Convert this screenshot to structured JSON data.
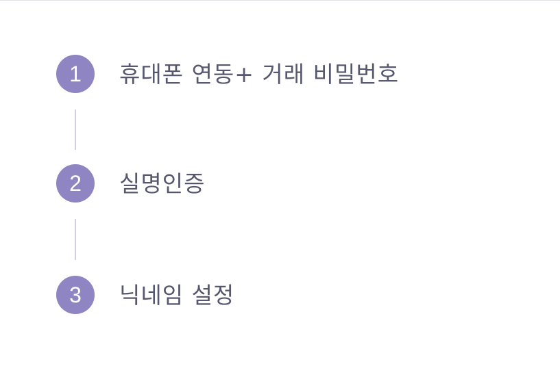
{
  "steps": [
    {
      "number": "1",
      "label": "휴대폰 연동+ 거래 비밀번호",
      "state": "active"
    },
    {
      "number": "2",
      "label": "실명인증",
      "state": "active"
    },
    {
      "number": "3",
      "label": "닉네임 설정",
      "state": "active"
    }
  ],
  "colors": {
    "accent": "#8f85c3",
    "label_text": "#585770",
    "connector": "#d3d0e6",
    "divider": "#e2e2e6",
    "background": "#ffffff"
  }
}
